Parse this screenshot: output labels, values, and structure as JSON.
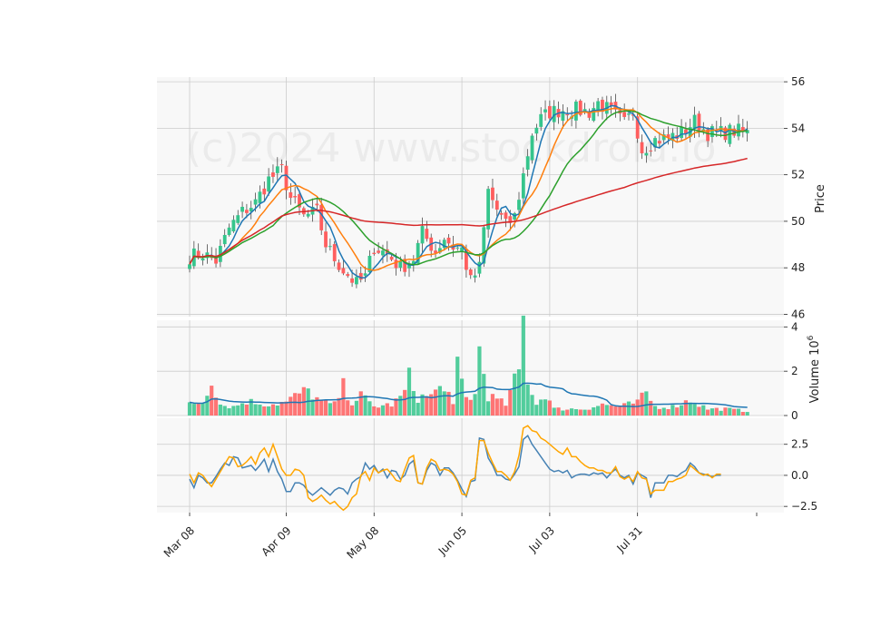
{
  "chart_data": {
    "type": "candlestick",
    "watermark": "(c)2024 www.stockdroid.io",
    "x_tick_labels": [
      "Mar 08",
      "Apr 09",
      "May 08",
      "Jun 05",
      "Jul 03",
      "Jul 31"
    ],
    "x_tick_index": [
      0,
      22,
      42,
      62,
      82,
      102
    ],
    "n_points": 128,
    "anchors": {
      "close": [
        [
          0,
          48.5
        ],
        [
          3,
          48.6
        ],
        [
          6,
          48.3
        ],
        [
          9,
          49.7
        ],
        [
          12,
          50.4
        ],
        [
          15,
          50.8
        ],
        [
          18,
          51.8
        ],
        [
          21,
          52.2
        ],
        [
          23,
          51.0
        ],
        [
          26,
          50.2
        ],
        [
          29,
          50.4
        ],
        [
          31,
          49.0
        ],
        [
          33,
          48.4
        ],
        [
          35,
          47.9
        ],
        [
          38,
          47.3
        ],
        [
          40,
          47.6
        ],
        [
          42,
          48.9
        ],
        [
          45,
          48.6
        ],
        [
          48,
          48.0
        ],
        [
          51,
          48.4
        ],
        [
          53,
          49.5
        ],
        [
          56,
          48.7
        ],
        [
          58,
          49.3
        ],
        [
          60,
          48.9
        ],
        [
          62,
          48.8
        ],
        [
          64,
          47.4
        ],
        [
          66,
          48.0
        ],
        [
          68,
          51.3
        ],
        [
          70,
          50.5
        ],
        [
          72,
          49.8
        ],
        [
          74,
          50.2
        ],
        [
          76,
          52.0
        ],
        [
          78,
          53.8
        ],
        [
          80,
          54.4
        ],
        [
          82,
          54.7
        ],
        [
          85,
          54.8
        ],
        [
          88,
          54.8
        ],
        [
          91,
          54.7
        ],
        [
          93,
          55.1
        ],
        [
          96,
          54.7
        ],
        [
          99,
          54.2
        ],
        [
          101,
          54.7
        ],
        [
          103,
          53.1
        ],
        [
          106,
          53.5
        ],
        [
          109,
          53.6
        ],
        [
          112,
          53.8
        ],
        [
          115,
          54.3
        ],
        [
          118,
          53.8
        ],
        [
          121,
          53.8
        ],
        [
          124,
          53.9
        ],
        [
          127,
          53.8
        ]
      ],
      "volume": [
        [
          0,
          0.55
        ],
        [
          3,
          0.6
        ],
        [
          5,
          1.7
        ],
        [
          7,
          0.5
        ],
        [
          10,
          0.4
        ],
        [
          13,
          0.65
        ],
        [
          18,
          0.5
        ],
        [
          22,
          0.6
        ],
        [
          25,
          1.0
        ],
        [
          27,
          1.1
        ],
        [
          30,
          0.6
        ],
        [
          33,
          0.5
        ],
        [
          35,
          1.3
        ],
        [
          37,
          0.6
        ],
        [
          39,
          0.9
        ],
        [
          42,
          0.4
        ],
        [
          46,
          0.5
        ],
        [
          48,
          0.8
        ],
        [
          49,
          1.1
        ],
        [
          50,
          1.7
        ],
        [
          52,
          0.8
        ],
        [
          55,
          0.9
        ],
        [
          57,
          1.2
        ],
        [
          58,
          1.5
        ],
        [
          60,
          0.4
        ],
        [
          61,
          2.2
        ],
        [
          63,
          0.8
        ],
        [
          65,
          0.9
        ],
        [
          66,
          3.0
        ],
        [
          68,
          0.9
        ],
        [
          72,
          0.5
        ],
        [
          75,
          2.0
        ],
        [
          76,
          4.2
        ],
        [
          77,
          1.7
        ],
        [
          79,
          0.5
        ],
        [
          81,
          1.0
        ],
        [
          83,
          0.3
        ],
        [
          86,
          0.3
        ],
        [
          90,
          0.3
        ],
        [
          94,
          0.5
        ],
        [
          98,
          0.4
        ],
        [
          102,
          0.6
        ],
        [
          104,
          1.0
        ],
        [
          106,
          0.4
        ],
        [
          110,
          0.4
        ],
        [
          114,
          0.7
        ],
        [
          118,
          0.3
        ],
        [
          122,
          0.3
        ],
        [
          127,
          0.2
        ]
      ],
      "osc_blue": [
        [
          0,
          -0.3
        ],
        [
          1,
          -1.0
        ],
        [
          2,
          0.0
        ],
        [
          3,
          -0.2
        ],
        [
          4,
          -0.6
        ],
        [
          5,
          -0.6
        ],
        [
          6,
          -0.1
        ],
        [
          7,
          0.5
        ],
        [
          8,
          1.0
        ],
        [
          9,
          0.8
        ],
        [
          10,
          1.5
        ],
        [
          11,
          1.4
        ],
        [
          12,
          0.6
        ],
        [
          13,
          0.7
        ],
        [
          14,
          0.8
        ],
        [
          15,
          0.4
        ],
        [
          16,
          0.8
        ],
        [
          17,
          1.3
        ],
        [
          18,
          0.3
        ],
        [
          19,
          1.3
        ],
        [
          20,
          0.3
        ],
        [
          21,
          -0.3
        ],
        [
          22,
          -1.3
        ],
        [
          23,
          -1.3
        ],
        [
          24,
          -0.6
        ],
        [
          25,
          -0.6
        ],
        [
          26,
          -0.8
        ],
        [
          27,
          -1.3
        ],
        [
          28,
          -1.6
        ],
        [
          29,
          -1.3
        ],
        [
          30,
          -1.0
        ],
        [
          31,
          -1.3
        ],
        [
          32,
          -1.6
        ],
        [
          33,
          -1.2
        ],
        [
          34,
          -1.0
        ],
        [
          35,
          -1.1
        ],
        [
          36,
          -1.5
        ],
        [
          37,
          -0.6
        ],
        [
          38,
          -0.3
        ],
        [
          39,
          -0.1
        ],
        [
          40,
          1.0
        ],
        [
          41,
          0.5
        ],
        [
          42,
          0.8
        ],
        [
          43,
          0.2
        ],
        [
          44,
          0.5
        ],
        [
          45,
          -0.2
        ],
        [
          46,
          0.4
        ],
        [
          47,
          0.3
        ],
        [
          48,
          -0.3
        ],
        [
          49,
          0.0
        ],
        [
          50,
          0.9
        ],
        [
          51,
          1.2
        ],
        [
          52,
          -0.6
        ],
        [
          53,
          -0.7
        ],
        [
          54,
          0.4
        ],
        [
          55,
          1.0
        ],
        [
          56,
          0.8
        ],
        [
          57,
          0.0
        ],
        [
          58,
          0.6
        ],
        [
          59,
          0.6
        ],
        [
          60,
          0.2
        ],
        [
          61,
          -0.4
        ],
        [
          62,
          -1.1
        ],
        [
          63,
          -1.7
        ],
        [
          64,
          -0.5
        ],
        [
          65,
          -0.4
        ],
        [
          66,
          3.0
        ],
        [
          67,
          2.9
        ],
        [
          68,
          1.4
        ],
        [
          69,
          0.8
        ],
        [
          70,
          0.0
        ],
        [
          71,
          0.0
        ],
        [
          72,
          -0.3
        ],
        [
          73,
          -0.4
        ],
        [
          74,
          0.1
        ],
        [
          75,
          0.7
        ],
        [
          76,
          2.9
        ],
        [
          77,
          3.2
        ],
        [
          78,
          2.5
        ],
        [
          79,
          2.0
        ],
        [
          80,
          1.5
        ],
        [
          81,
          1.0
        ],
        [
          82,
          0.5
        ],
        [
          83,
          0.3
        ],
        [
          84,
          0.4
        ],
        [
          85,
          0.2
        ],
        [
          86,
          0.4
        ],
        [
          87,
          -0.2
        ],
        [
          88,
          0.0
        ],
        [
          89,
          0.1
        ],
        [
          90,
          0.1
        ],
        [
          91,
          0.0
        ],
        [
          92,
          0.2
        ],
        [
          93,
          0.1
        ],
        [
          94,
          0.2
        ],
        [
          95,
          -0.2
        ],
        [
          96,
          0.2
        ],
        [
          97,
          0.5
        ],
        [
          98,
          0.0
        ],
        [
          99,
          -0.2
        ],
        [
          100,
          0.0
        ],
        [
          101,
          -0.7
        ],
        [
          102,
          0.2
        ],
        [
          103,
          0.0
        ],
        [
          104,
          -0.2
        ],
        [
          105,
          -1.8
        ],
        [
          106,
          -0.6
        ],
        [
          107,
          -0.6
        ],
        [
          108,
          -0.6
        ],
        [
          109,
          0.0
        ],
        [
          110,
          0.0
        ],
        [
          111,
          -0.1
        ],
        [
          112,
          0.2
        ],
        [
          113,
          0.4
        ],
        [
          114,
          1.0
        ],
        [
          115,
          0.7
        ],
        [
          116,
          0.2
        ],
        [
          117,
          0.1
        ],
        [
          118,
          0.0
        ],
        [
          119,
          -0.1
        ],
        [
          120,
          0.0
        ],
        [
          121,
          0.0
        ]
      ],
      "osc_orange": [
        [
          0,
          0.1
        ],
        [
          1,
          -0.6
        ],
        [
          2,
          0.2
        ],
        [
          3,
          0.0
        ],
        [
          4,
          -0.5
        ],
        [
          5,
          -0.9
        ],
        [
          6,
          -0.3
        ],
        [
          7,
          0.3
        ],
        [
          8,
          0.9
        ],
        [
          9,
          1.5
        ],
        [
          10,
          1.4
        ],
        [
          11,
          0.7
        ],
        [
          12,
          0.8
        ],
        [
          13,
          1.1
        ],
        [
          14,
          1.5
        ],
        [
          15,
          0.9
        ],
        [
          16,
          1.8
        ],
        [
          17,
          2.2
        ],
        [
          18,
          1.5
        ],
        [
          19,
          2.5
        ],
        [
          20,
          1.5
        ],
        [
          21,
          0.5
        ],
        [
          22,
          0.0
        ],
        [
          23,
          0.0
        ],
        [
          24,
          0.5
        ],
        [
          25,
          0.4
        ],
        [
          26,
          0.0
        ],
        [
          27,
          -1.8
        ],
        [
          28,
          -2.1
        ],
        [
          29,
          -1.9
        ],
        [
          30,
          -1.6
        ],
        [
          31,
          -2.0
        ],
        [
          32,
          -2.3
        ],
        [
          33,
          -2.1
        ],
        [
          34,
          -2.5
        ],
        [
          35,
          -2.8
        ],
        [
          36,
          -2.5
        ],
        [
          37,
          -1.8
        ],
        [
          38,
          -1.5
        ],
        [
          39,
          0.0
        ],
        [
          40,
          0.3
        ],
        [
          41,
          -0.4
        ],
        [
          42,
          0.6
        ],
        [
          43,
          0.2
        ],
        [
          44,
          0.4
        ],
        [
          45,
          0.5
        ],
        [
          46,
          0.1
        ],
        [
          47,
          -0.4
        ],
        [
          48,
          -0.5
        ],
        [
          49,
          0.5
        ],
        [
          50,
          1.4
        ],
        [
          51,
          1.6
        ],
        [
          52,
          -0.6
        ],
        [
          53,
          -0.7
        ],
        [
          54,
          0.6
        ],
        [
          55,
          1.3
        ],
        [
          56,
          1.1
        ],
        [
          57,
          0.4
        ],
        [
          58,
          0.5
        ],
        [
          59,
          0.4
        ],
        [
          60,
          0.1
        ],
        [
          61,
          -0.5
        ],
        [
          62,
          -1.5
        ],
        [
          63,
          -1.6
        ],
        [
          64,
          -0.4
        ],
        [
          65,
          -0.2
        ],
        [
          66,
          2.8
        ],
        [
          67,
          2.8
        ],
        [
          68,
          1.8
        ],
        [
          69,
          1.0
        ],
        [
          70,
          0.3
        ],
        [
          71,
          0.3
        ],
        [
          72,
          0.0
        ],
        [
          73,
          -0.4
        ],
        [
          74,
          0.3
        ],
        [
          75,
          1.6
        ],
        [
          76,
          3.8
        ],
        [
          77,
          4.0
        ],
        [
          78,
          3.6
        ],
        [
          79,
          3.5
        ],
        [
          80,
          3.0
        ],
        [
          81,
          2.8
        ],
        [
          82,
          2.5
        ],
        [
          83,
          2.2
        ],
        [
          84,
          1.9
        ],
        [
          85,
          1.7
        ],
        [
          86,
          2.2
        ],
        [
          87,
          1.5
        ],
        [
          88,
          1.5
        ],
        [
          89,
          1.1
        ],
        [
          90,
          0.8
        ],
        [
          91,
          0.6
        ],
        [
          92,
          0.6
        ],
        [
          93,
          0.4
        ],
        [
          94,
          0.4
        ],
        [
          95,
          0.2
        ],
        [
          96,
          0.2
        ],
        [
          97,
          0.7
        ],
        [
          98,
          -0.1
        ],
        [
          99,
          -0.3
        ],
        [
          100,
          -0.1
        ],
        [
          101,
          -0.5
        ],
        [
          102,
          0.3
        ],
        [
          103,
          -0.2
        ],
        [
          104,
          -0.3
        ],
        [
          105,
          -1.5
        ],
        [
          106,
          -1.2
        ],
        [
          107,
          -1.2
        ],
        [
          108,
          -1.2
        ],
        [
          109,
          -0.5
        ],
        [
          110,
          -0.5
        ],
        [
          111,
          -0.3
        ],
        [
          112,
          -0.2
        ],
        [
          113,
          0.0
        ],
        [
          114,
          0.8
        ],
        [
          115,
          0.5
        ],
        [
          116,
          0.2
        ],
        [
          117,
          0.0
        ],
        [
          118,
          0.1
        ],
        [
          119,
          -0.2
        ],
        [
          120,
          0.1
        ],
        [
          121,
          0.1
        ]
      ]
    },
    "moving_averages": [
      {
        "color": "#1f77b4",
        "period": 5
      },
      {
        "color": "#ff7f0e",
        "period": 10
      },
      {
        "color": "#2ca02c",
        "period": 20
      },
      {
        "color": "#d62728",
        "period": 100
      }
    ],
    "price_axis": {
      "label": "Price",
      "ylim": [
        45.9,
        56.2
      ],
      "ticks": [
        46,
        48,
        50,
        52,
        54,
        56
      ]
    },
    "volume_axis": {
      "label": "Volume",
      "exponent_label": "10",
      "exponent": "6",
      "ylim": [
        0,
        4.3
      ],
      "ticks": [
        0,
        2,
        4
      ],
      "ma_color": "#1f77b4",
      "ma_period": 20
    },
    "oscillator_axis": {
      "ylim": [
        -3.0,
        4.6
      ],
      "ticks": [
        -2.5,
        0.0,
        2.5
      ],
      "tick_labels": [
        "−2.5",
        "0.0",
        "2.5"
      ],
      "line_colors": [
        "#4682b4",
        "#ffa500"
      ]
    },
    "colors": {
      "up": "#35c58c",
      "down": "#ff5e5e",
      "panel_bg": "#f8f8f8",
      "grid": "#cccccc"
    },
    "grid": true
  }
}
